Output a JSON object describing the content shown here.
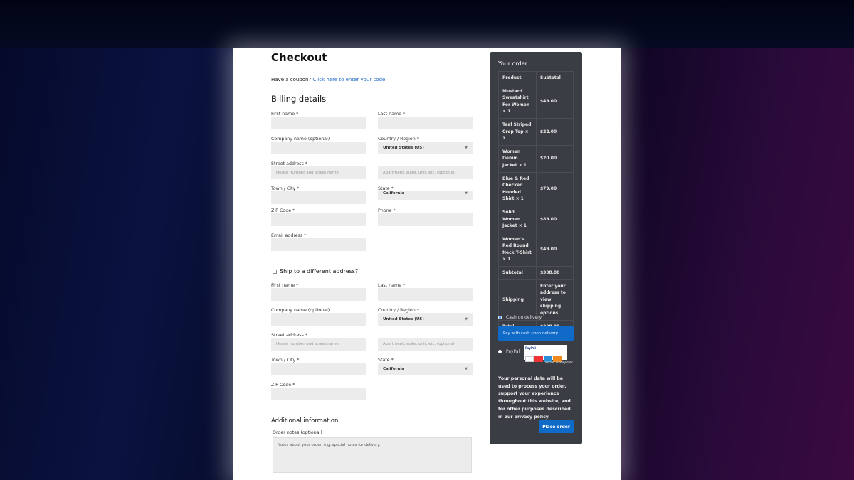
{
  "title": "Checkout",
  "coupon": {
    "text": "Have a coupon?",
    "link": "Click here to enter your code"
  },
  "billing": {
    "heading": "Billing details",
    "fields": [
      {
        "label": "First name *",
        "value": ""
      },
      {
        "label": "Last name *",
        "value": ""
      },
      {
        "label": "Company name (optional)",
        "value": ""
      },
      {
        "label": "Country / Region *",
        "value": "United States (US)",
        "type": "select"
      },
      {
        "label": "Street address *",
        "placeholder": "House number and street name"
      },
      {
        "label": "",
        "placeholder": "Apartment, suite, unit, etc. (optional)"
      },
      {
        "label": "Town / City *",
        "value": ""
      },
      {
        "label": "State *",
        "value": "California",
        "type": "select"
      },
      {
        "label": "ZIP Code *",
        "value": ""
      },
      {
        "label": "Phone *",
        "value": ""
      },
      {
        "label": "Email address *",
        "value": ""
      }
    ]
  },
  "shipping": {
    "checkbox_label": "Ship to a different address?",
    "checked": false,
    "fields": [
      {
        "label": "First name *",
        "value": ""
      },
      {
        "label": "Last name *",
        "value": ""
      },
      {
        "label": "Company name (optional)",
        "value": ""
      },
      {
        "label": "Country / Region *",
        "value": "United States (US)",
        "type": "select"
      },
      {
        "label": "Street address *",
        "placeholder": "House number and street name"
      },
      {
        "label": "",
        "placeholder": "Apartment, suite, unit, etc. (optional)"
      },
      {
        "label": "Town / City *",
        "value": ""
      },
      {
        "label": "State *",
        "value": "California",
        "type": "select"
      },
      {
        "label": "ZIP Code *",
        "value": ""
      }
    ]
  },
  "additional": {
    "heading": "Additional information",
    "notes_label": "Order notes (optional)",
    "notes_placeholder": "Notes about your order, e.g. special notes for delivery."
  },
  "order": {
    "title": "Your order",
    "headers": [
      "Product",
      "Subtotal"
    ],
    "items": [
      {
        "product": "Mustard Sweatshirt For Women  × 1",
        "subtotal": "$49.00"
      },
      {
        "product": "Teal Striped Crop Top  × 1",
        "subtotal": "$22.00"
      },
      {
        "product": "Women Denim Jacket  × 1",
        "subtotal": "$20.00"
      },
      {
        "product": "Blue & Red Checked Hooded Shirt  × 1",
        "subtotal": "$79.00"
      },
      {
        "product": "Solid Women Jacket  × 1",
        "subtotal": "$89.00"
      },
      {
        "product": "Women's Red Round Neck T-Shirt  × 1",
        "subtotal": "$49.00"
      }
    ],
    "subtotal_label": "Subtotal",
    "subtotal": "$308.00",
    "shipping_label": "Shipping",
    "shipping_text": "Enter your address to view shipping options.",
    "total_label": "Total",
    "total": "$308.00"
  },
  "payment": {
    "cod_label": "Cash on delivery",
    "cod_selected": true,
    "cod_desc": "Pay with cash upon delivery.",
    "paypal_label": "PayPal",
    "paypal_logo_text": "PayPal",
    "what_is_paypal": "What is PayPal?",
    "privacy": "Your personal data will be used to process your order, support your experience throughout this website, and for other purposes described in our privacy policy.",
    "place_order": "Place order"
  },
  "colors": {
    "accent": "#0f6ac8",
    "panel": "#3a3d43",
    "input": "#ececec"
  }
}
